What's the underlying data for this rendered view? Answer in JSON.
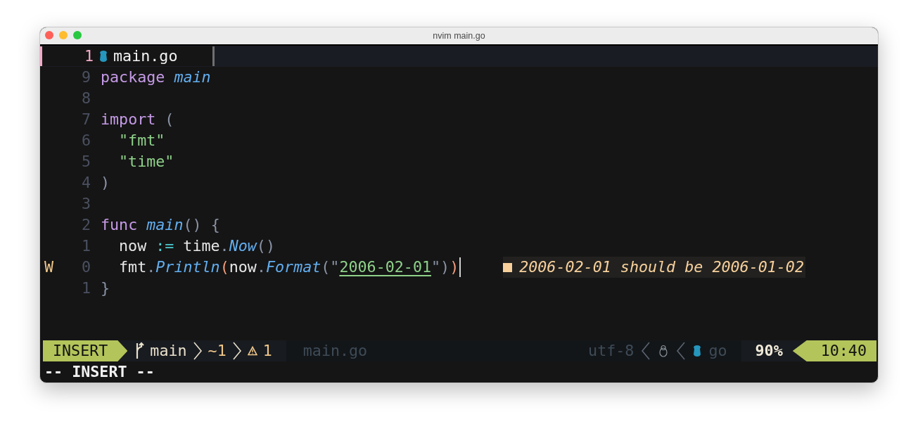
{
  "window": {
    "title": "nvim main.go"
  },
  "tabline": {
    "tabs": [
      {
        "number": "1",
        "name": "main.go",
        "selected": true
      }
    ]
  },
  "lines": [
    {
      "number": "9",
      "tokens": [
        {
          "kind": "keyword",
          "text": "package"
        },
        {
          "kind": "ident",
          "text": "main",
          "space_before": true
        }
      ]
    },
    {
      "number": "8"
    },
    {
      "number": "7",
      "tokens": [
        {
          "kind": "keyword",
          "text": "import"
        },
        {
          "kind": "punct",
          "text": "(",
          "space_before": true
        }
      ]
    },
    {
      "number": "6",
      "indented": true,
      "tokens": [
        {
          "kind": "string",
          "text": "\"fmt\""
        }
      ]
    },
    {
      "number": "5",
      "indented": true,
      "tokens": [
        {
          "kind": "string",
          "text": "\"time\""
        }
      ]
    },
    {
      "number": "4",
      "tokens": [
        {
          "kind": "punct",
          "text": ")"
        }
      ]
    },
    {
      "number": "3"
    },
    {
      "number": "2",
      "tokens": [
        {
          "kind": "keyword",
          "text": "func"
        },
        {
          "kind": "ident",
          "text": "main",
          "space_before": true
        },
        {
          "kind": "punct",
          "text": "() {"
        }
      ]
    },
    {
      "number": "1",
      "indented": true,
      "tokens": [
        {
          "kind": "plain",
          "text": "now"
        },
        {
          "kind": "op",
          "text": ":=",
          "space_before": true
        },
        {
          "kind": "plain",
          "text": "time",
          "space_before": true
        },
        {
          "kind": "punct",
          "text": "."
        },
        {
          "kind": "ident",
          "text": "Now"
        },
        {
          "kind": "punct",
          "text": "()"
        }
      ]
    },
    {
      "number": "0",
      "sign": "W",
      "cursor": true,
      "indented": true,
      "tokens": [
        {
          "kind": "plain",
          "text": "fmt"
        },
        {
          "kind": "punct",
          "text": "."
        },
        {
          "kind": "ident",
          "text": "Println"
        },
        {
          "kind": "paren",
          "text": "("
        },
        {
          "kind": "plain",
          "text": "now"
        },
        {
          "kind": "punct",
          "text": "."
        },
        {
          "kind": "ident",
          "text": "Format"
        },
        {
          "kind": "punct",
          "text": "(\""
        },
        {
          "kind": "string",
          "text": "2006-02-01",
          "underline": true
        },
        {
          "kind": "punct",
          "text": "\")"
        },
        {
          "kind": "paren",
          "text": ")"
        }
      ],
      "virtual_text": "2006-02-01 should be 2006-01-02"
    },
    {
      "number": "1",
      "tokens": [
        {
          "kind": "punct",
          "text": "}"
        }
      ]
    }
  ],
  "statusline": {
    "mode": "INSERT",
    "branch": "main",
    "changes": "~1",
    "warnings": "1",
    "file": "main.go",
    "encoding": "utf-8",
    "filetype": "go",
    "progress": "90%",
    "time": "10:40"
  },
  "cmdline": "-- INSERT --"
}
